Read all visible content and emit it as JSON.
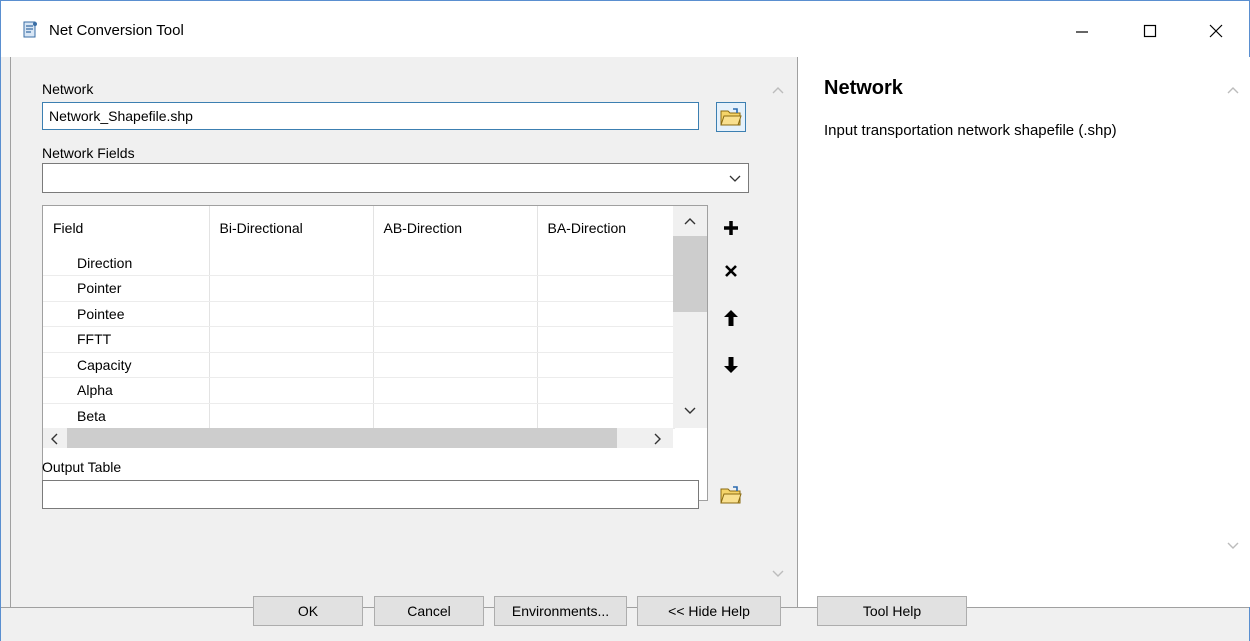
{
  "window": {
    "title": "Net Conversion Tool"
  },
  "network": {
    "label": "Network",
    "value": "Network_Shapefile.shp"
  },
  "network_fields": {
    "label": "Network Fields",
    "value": ""
  },
  "grid": {
    "headers": [
      "Field",
      "Bi-Directional",
      "AB-Direction",
      "BA-Direction"
    ],
    "rows": [
      "Direction",
      "Pointer",
      "Pointee",
      "FFTT",
      "Capacity",
      "Alpha",
      "Beta"
    ]
  },
  "output_table": {
    "label": "Output Table",
    "value": ""
  },
  "help": {
    "title": "Network",
    "text": "Input transportation network shapefile (.shp)"
  },
  "buttons": {
    "ok": "OK",
    "cancel": "Cancel",
    "environments": "Environments...",
    "hide_help": "<< Hide Help",
    "tool_help": "Tool Help"
  },
  "colors": {
    "focus_border": "#3c7fb1",
    "window_border": "#5a8fd0",
    "panel_bg": "#f0f0f0"
  }
}
